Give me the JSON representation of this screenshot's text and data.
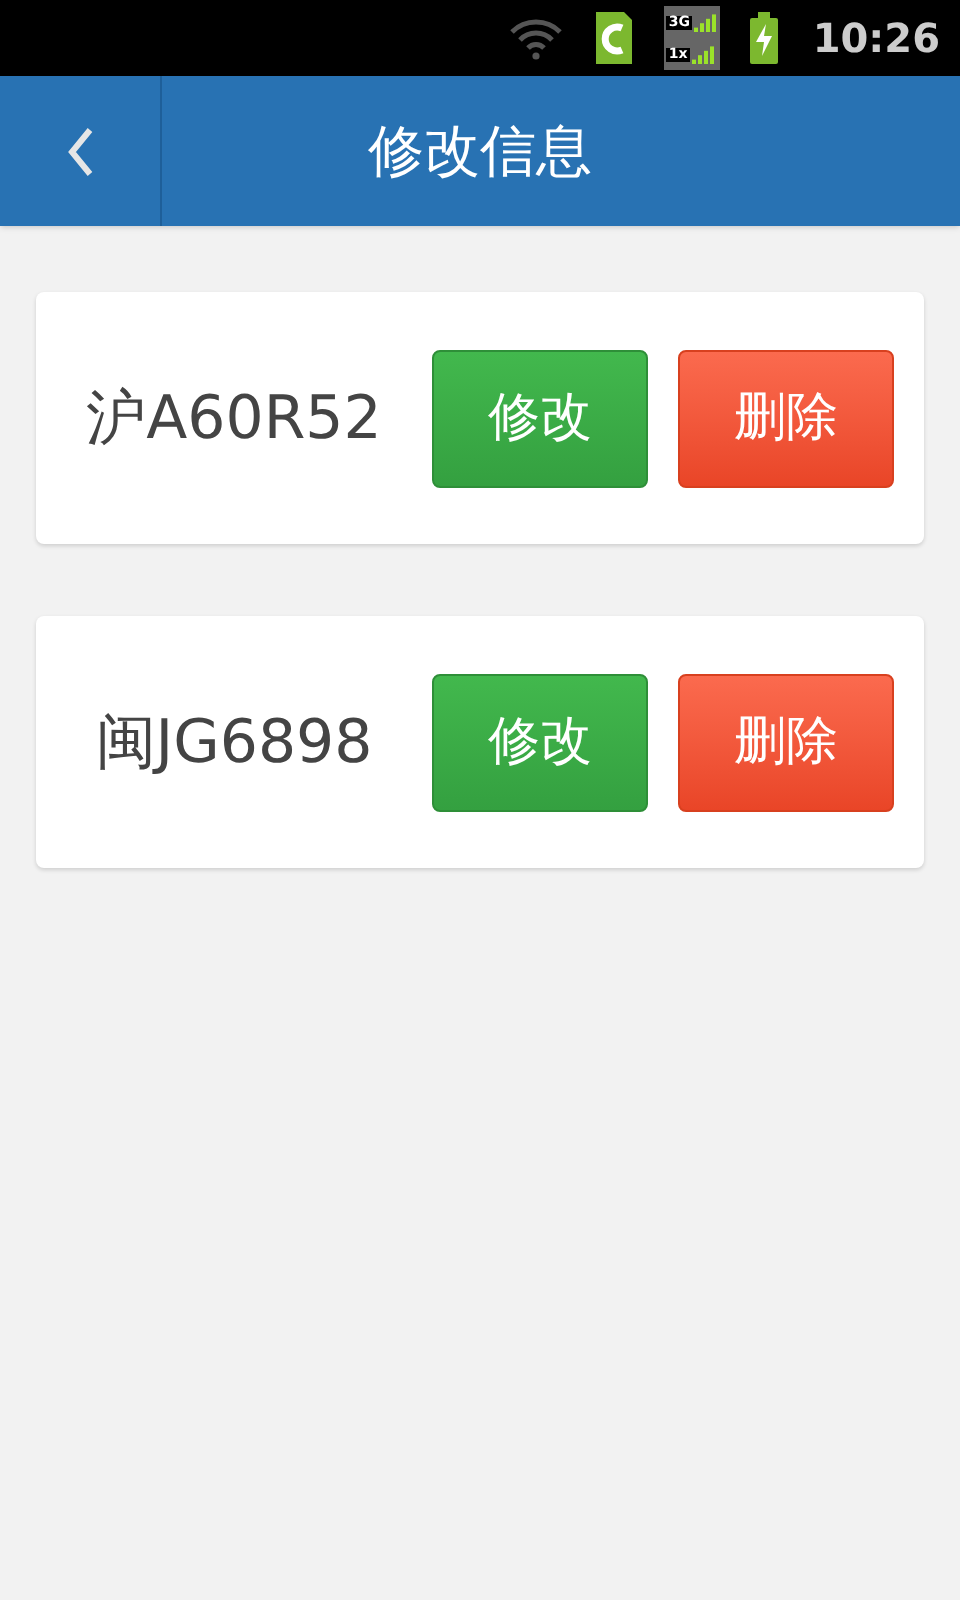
{
  "status_bar": {
    "time": "10:26",
    "network_top": "3G",
    "network_bottom": "1x"
  },
  "header": {
    "title": "修改信息"
  },
  "vehicles": [
    {
      "plate": "沪A60R52",
      "edit_label": "修改",
      "delete_label": "删除"
    },
    {
      "plate": "闽JG6898",
      "edit_label": "修改",
      "delete_label": "删除"
    }
  ]
}
